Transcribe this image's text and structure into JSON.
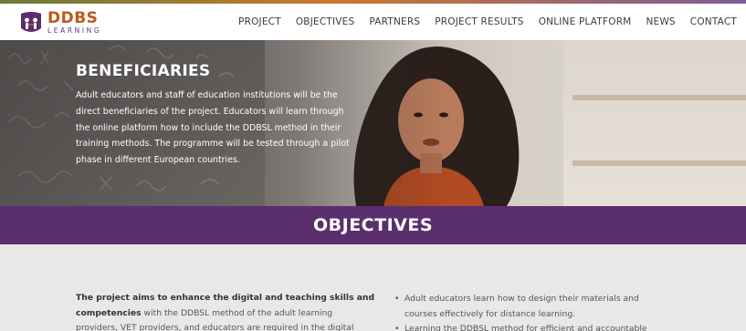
{
  "brand": {
    "logo_main": "DDBS",
    "logo_sub": "LEARNING",
    "primary_color": "#5b2e6e",
    "accent_color": "#c0571f"
  },
  "nav": {
    "items": [
      "PROJECT",
      "OBJECTIVES",
      "PARTNERS",
      "PROJECT RESULTS",
      "ONLINE PLATFORM",
      "NEWS",
      "CONTACT"
    ]
  },
  "hero": {
    "title": "BENEFICIARIES",
    "text": "Adult educators and staff of education institutions will be the direct beneficiaries of the project. Educators will learn through the online platform how to include the DDBSL method in their training methods. The programme will be tested through a pilot phase in different European countries."
  },
  "objectives": {
    "heading": "OBJECTIVES",
    "intro_bold": "The project aims to enhance the digital and teaching skills and competencies",
    "intro_rest": " with the DDBSL method of the adult learning providers, VET providers, and educators are required in the digital",
    "bullets": [
      "Adult educators learn how to design their materials and courses effectively for distance learning.",
      "Learning the DDBSL method for efficient and accountable"
    ]
  }
}
